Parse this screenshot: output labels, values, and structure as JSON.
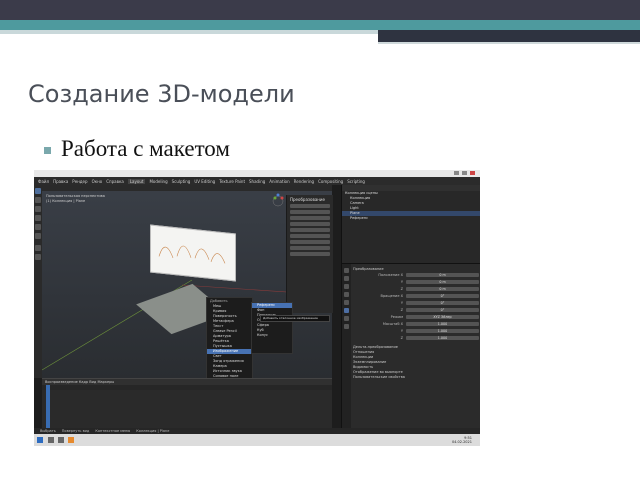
{
  "slide": {
    "title": "Создание 3D-модели",
    "bullet": "Работа с макетом"
  },
  "blender": {
    "menu": [
      "Файл",
      "Правка",
      "Рендер",
      "Окно",
      "Справка",
      "Layout",
      "Modeling",
      "Sculpting",
      "UV Editing",
      "Texture Paint",
      "Shading",
      "Animation",
      "Rendering",
      "Compositing",
      "Scripting"
    ],
    "viewport_info": [
      "Пользовательская перспектива",
      "(1) Коллекция | Plane"
    ],
    "npanel_title": "Преобразование",
    "context_menu": {
      "title": "Добавить",
      "items": [
        "Меш",
        "Кривая",
        "Поверхность",
        "Метасфера",
        "Текст",
        "Grease Pencil",
        "Арматура",
        "Решётка",
        "Пустышка",
        "Изображение",
        "Свет",
        "Зонд отражения",
        "Камера",
        "Источник звука",
        "Силовое поле",
        "Экземпляр коллекции"
      ],
      "highlight_index": 9
    },
    "submenu": {
      "items": [
        "Референс",
        "Фон",
        "Плоскость",
        "Ось",
        "Сфера",
        "Куб",
        "Конус"
      ],
      "highlight_index": 0
    },
    "tooltip": "Добавить эталонное изображение",
    "timeline": {
      "header": "Воспроизведение   Кадр   Вид   Маркеры"
    },
    "outliner": {
      "rows": [
        "Коллекция сцены",
        "Коллекция",
        "Camera",
        "Light",
        "Plane",
        "Референс"
      ],
      "selected_index": 4
    },
    "properties": {
      "section": "Преобразование",
      "rows": [
        {
          "label": "Положение X",
          "value": "0 m"
        },
        {
          "label": "Y",
          "value": "0 m"
        },
        {
          "label": "Z",
          "value": "0 m"
        },
        {
          "label": "Вращение X",
          "value": "0°"
        },
        {
          "label": "Y",
          "value": "0°"
        },
        {
          "label": "Z",
          "value": "0°"
        },
        {
          "label": "Режим",
          "value": "XYZ Эйлер"
        },
        {
          "label": "Масштаб X",
          "value": "1.000"
        },
        {
          "label": "Y",
          "value": "1.000"
        },
        {
          "label": "Z",
          "value": "1.000"
        }
      ],
      "sections": [
        "Дельта-преобразование",
        "Отношения",
        "Коллекции",
        "Экземплирование",
        "Видимость",
        "Отображение во вьюпорте",
        "Пользовательские свойства"
      ]
    },
    "statusbar": [
      "Выбрать",
      "Повернуть вид",
      "Контекстное меню",
      "Коллекция | Plane"
    ]
  },
  "taskbar": {
    "time": "9:51",
    "date": "04.02.2021"
  },
  "colors": {
    "teal": "#4e9a9e",
    "accent_blue": "#4772b3"
  }
}
